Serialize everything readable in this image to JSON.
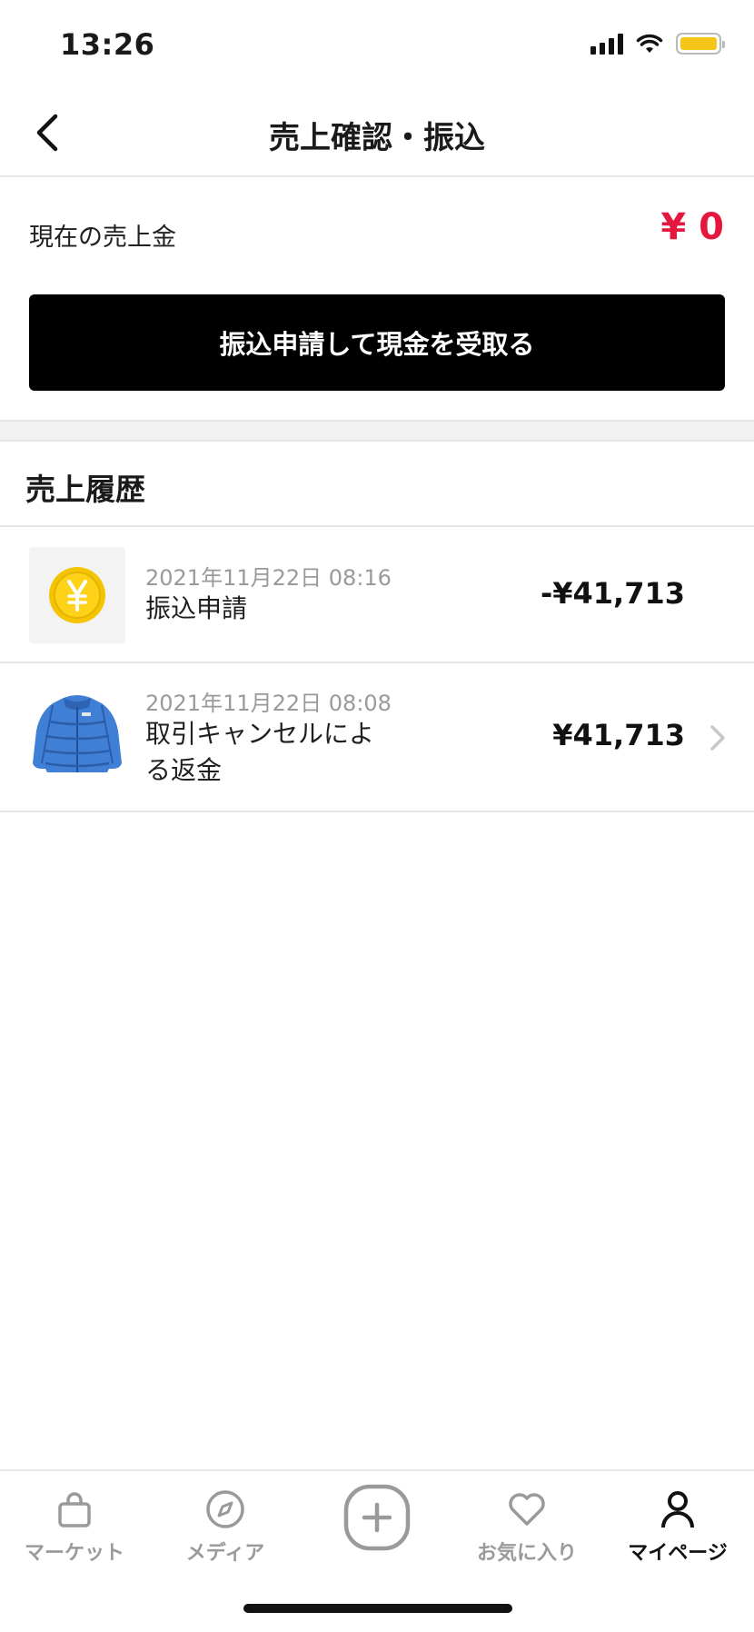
{
  "status_bar": {
    "time": "13:26"
  },
  "header": {
    "title": "売上確認・振込"
  },
  "balance": {
    "label": "現在の売上金",
    "amount": "¥ 0",
    "amount_color": "#e5173f",
    "transfer_button_label": "振込申請して現金を受取る"
  },
  "history": {
    "title": "売上履歴",
    "items": [
      {
        "icon": "yen-coin-icon",
        "date": "2021年11月22日 08:16",
        "title": "振込申請",
        "amount": "-¥41,713"
      },
      {
        "icon": "blue-puffer-jacket-image",
        "date": "2021年11月22日 08:08",
        "title": "取引キャンセルによる返金",
        "amount": "¥41,713"
      }
    ]
  },
  "tab_bar": {
    "items": [
      {
        "label": "マーケット",
        "icon": "shopping-bag-icon",
        "active": false
      },
      {
        "label": "メディア",
        "icon": "compass-icon",
        "active": false
      },
      {
        "label": "",
        "icon": "plus-circle-icon",
        "active": false
      },
      {
        "label": "お気に入り",
        "icon": "heart-icon",
        "active": false
      },
      {
        "label": "マイページ",
        "icon": "person-icon",
        "active": true
      }
    ]
  }
}
